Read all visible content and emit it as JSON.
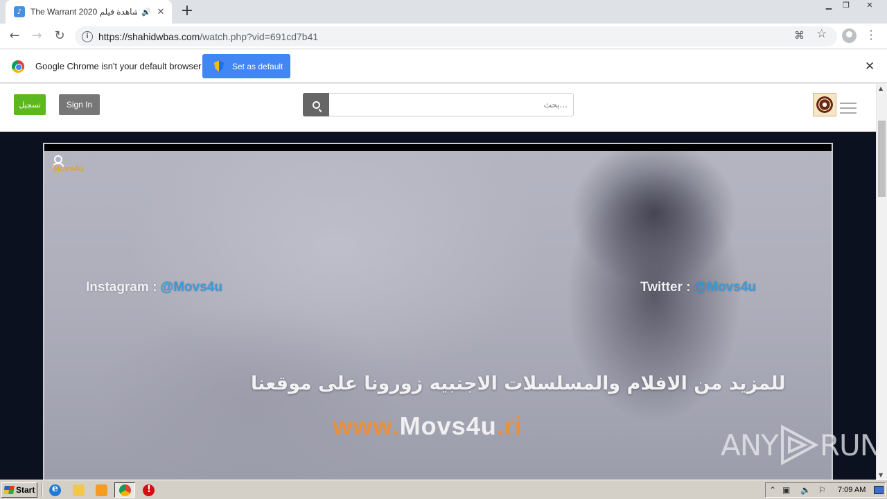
{
  "browser": {
    "tab_title": "The Warrant 2020 مشاهدة فيلم",
    "tab_audio_icon": "speaker-icon",
    "new_tab_label": "+",
    "url_host": "https://shahidwbas.com",
    "url_path": "/watch.php?vid=691cd7b41"
  },
  "infobar": {
    "message": "Google Chrome isn't your default browser",
    "button_label": "Set as default"
  },
  "site": {
    "register_label": "تسجيل",
    "signin_label": "Sign In",
    "search_placeholder": "بحث..."
  },
  "video": {
    "watermark": "Movs4u",
    "instagram_label": "Instagram : ",
    "instagram_handle": "@Movs4u",
    "twitter_label": "Twitter : ",
    "twitter_handle": "@Movs4u",
    "promo_text": "للمزيد من الافلام والمسلسلات الاجنبيه زورونا على موقعنا",
    "url_prefix": "www.",
    "url_name": "Movs4u",
    "url_suffix": ".ri"
  },
  "overlay": {
    "brand_left": "ANY",
    "brand_right": "RUN"
  },
  "taskbar": {
    "start_label": "Start",
    "clock": "7:09 AM"
  },
  "colors": {
    "chrome_blue": "#4285f4",
    "register_green": "#5cb81e",
    "signin_gray": "#777777",
    "content_bg": "#0c1120",
    "handle_blue": "#3a9bdc",
    "accent_orange": "#e89040"
  }
}
